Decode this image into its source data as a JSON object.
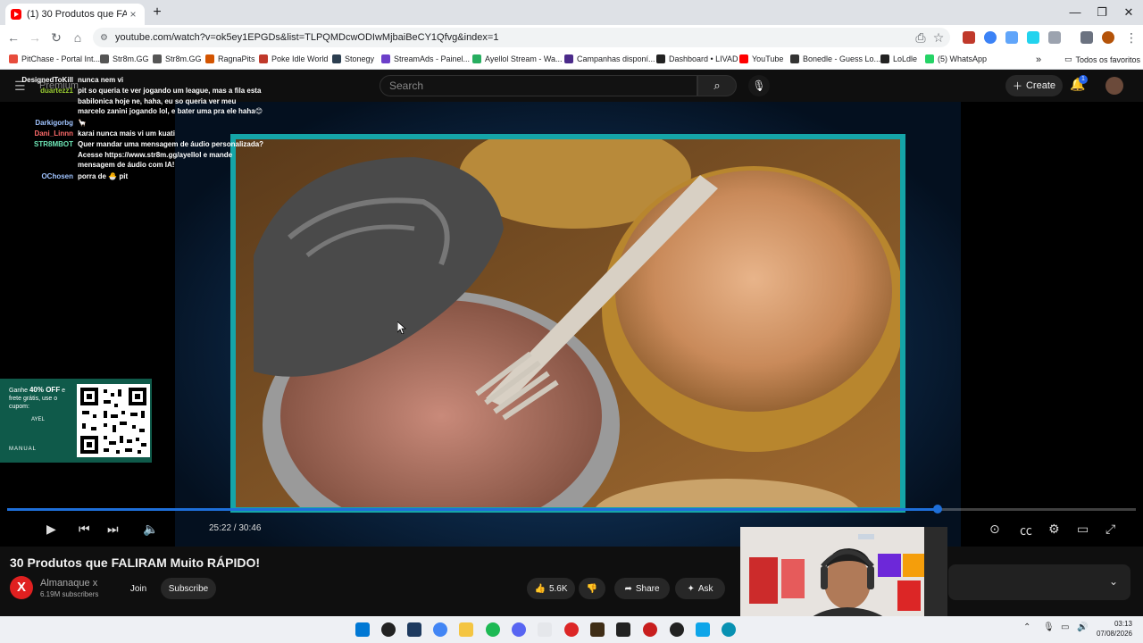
{
  "browser": {
    "tab_title": "(1) 30 Produtos que FALIRAM M",
    "tab_close": "×",
    "new_tab": "+",
    "url": "youtube.com/watch?v=ok5ey1EPGDs&list=TLPQMDcwODIwMjbaiBeCY1Qfvg&index=1",
    "window_min": "—",
    "window_max": "❐",
    "window_close": "✕"
  },
  "bookmarks": [
    {
      "label": "PitChase - Portal Int...",
      "color": "#e74c3c"
    },
    {
      "label": "Str8m.GG",
      "color": "#555555"
    },
    {
      "label": "Str8m.GG",
      "color": "#555555"
    },
    {
      "label": "RagnaPits",
      "color": "#d35400"
    },
    {
      "label": "Poke Idle World",
      "color": "#c0392b"
    },
    {
      "label": "Stonegy",
      "color": "#2c3e50"
    },
    {
      "label": "StreamAds - Painel...",
      "color": "#6c3fc9"
    },
    {
      "label": "Ayellol Stream - Wa...",
      "color": "#27ae60"
    },
    {
      "label": "Campanhas disponí...",
      "color": "#4b2a8a"
    },
    {
      "label": "Dashboard • LIVAD",
      "color": "#222222"
    },
    {
      "label": "YouTube",
      "color": "#ff0000"
    },
    {
      "label": "Bonedle - Guess Lo...",
      "color": "#333333"
    },
    {
      "label": "LoLdle",
      "color": "#222222"
    },
    {
      "label": "(5) WhatsApp",
      "color": "#25d366"
    }
  ],
  "bookmarks_more": "»",
  "bookmarks_all": "Todos os favoritos",
  "youtube": {
    "logo": "Premium",
    "search_placeholder": "Search",
    "create_label": "Create",
    "notification_count": "1"
  },
  "chat": [
    {
      "user": "DesignedToKill",
      "message": "nunca nem vi",
      "color": "#ffffff"
    },
    {
      "user": "duartezz1",
      "message": "pit so queria te ver jogando um league, mas a fila esta babilonica hoje ne, haha, eu so queria ver meu marcelo zanini jogando lol, e bater uma pra ele haha😊",
      "color": "#9acd32"
    },
    {
      "user": "Darkigorbg",
      "message": "🦙",
      "color": "#a0c4ff"
    },
    {
      "user": "Dani_Linnn",
      "message": "karai nunca mais vi um kuati",
      "color": "#ff6b6b"
    },
    {
      "user": "STR8MBOT",
      "message": "Quer mandar uma mensagem de áudio personalizada? Acesse https://www.str8m.gg/ayellol e mande mensagem de áudio com IA!",
      "color": "#6ee7b7"
    },
    {
      "user": "OChosen",
      "message": "porra de 🐣 pit",
      "color": "#a0c4ff"
    }
  ],
  "promo": {
    "text_pre": "Ganhe ",
    "text_bold": "40% OFF",
    "text_post": " e frete grátis, use o cupom:",
    "code": "AYEL",
    "brand": "MANUAL"
  },
  "player": {
    "time": "25:22 / 30:46",
    "progress": 0.8245
  },
  "video": {
    "title": "30 Produtos que FALIRAM Muito RÁPIDO!",
    "channel_initial": "X",
    "channel": "Almanaque x",
    "subscribers": "6.19M subscribers",
    "join": "Join",
    "subscribe": "Subscribe",
    "likes": "5.6K",
    "share": "Share",
    "ask": "Ask"
  },
  "taskbar": {
    "time": "03:13",
    "date": "07/08/2026"
  }
}
